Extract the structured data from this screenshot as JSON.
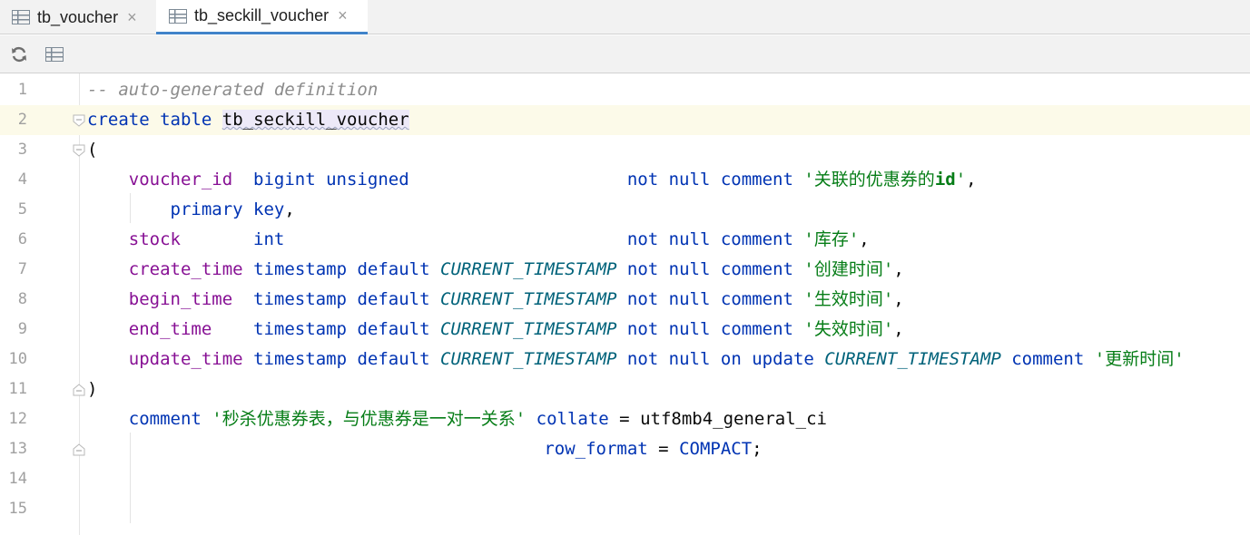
{
  "tabs": [
    {
      "label": "tb_voucher",
      "icon": "table-icon",
      "close": "×",
      "active": false
    },
    {
      "label": "tb_seckill_voucher",
      "icon": "table-icon",
      "close": "×",
      "active": true
    }
  ],
  "toolbar": {
    "buttons": [
      "refresh-icon",
      "table-view-icon"
    ]
  },
  "editor": {
    "line_numbers": [
      "1",
      "2",
      "3",
      "4",
      "5",
      "6",
      "7",
      "8",
      "9",
      "10",
      "11",
      "12",
      "13",
      "14",
      "15"
    ],
    "current_line": 2,
    "lines": {
      "l1": {
        "comment": "-- auto-generated definition"
      },
      "l2": {
        "kw_create": "create",
        "kw_table": "table",
        "table_name": "tb_seckill_voucher"
      },
      "l3": {
        "paren": "("
      },
      "l4": {
        "col": "voucher_id",
        "type": "bigint unsigned",
        "notnull": "not null",
        "kw_comment": "comment",
        "str_open": "'关联的优惠券的",
        "str_id": "id",
        "str_close": "'",
        "comma": ","
      },
      "l5": {
        "kw": "primary key",
        "comma": ","
      },
      "l6": {
        "col": "stock",
        "type": "int",
        "notnull": "not null",
        "kw_comment": "comment",
        "str": "'库存'",
        "comma": ","
      },
      "l7": {
        "col": "create_time",
        "type": "timestamp",
        "kw_default": "default",
        "fn": "CURRENT_TIMESTAMP",
        "notnull": "not null",
        "kw_comment": "comment",
        "str": "'创建时间'",
        "comma": ","
      },
      "l8": {
        "col": "begin_time",
        "type": "timestamp",
        "kw_default": "default",
        "fn": "CURRENT_TIMESTAMP",
        "notnull": "not null",
        "kw_comment": "comment",
        "str": "'生效时间'",
        "comma": ","
      },
      "l9": {
        "col": "end_time",
        "type": "timestamp",
        "kw_default": "default",
        "fn": "CURRENT_TIMESTAMP",
        "notnull": "not null",
        "kw_comment": "comment",
        "str": "'失效时间'",
        "comma": ","
      },
      "l10": {
        "col": "update_time",
        "type": "timestamp",
        "kw_default": "default",
        "fn": "CURRENT_TIMESTAMP",
        "notnull": "not null",
        "kw_on_update": "on update",
        "fn2": "CURRENT_TIMESTAMP",
        "kw_comment": "comment",
        "str": "'更新时间'"
      },
      "l11": {
        "paren": ")"
      },
      "l12": {
        "kw_comment": "comment",
        "str": "'秒杀优惠券表，与优惠券是一对一关系'",
        "kw_collate": "collate",
        "eq": "=",
        "value": "utf8mb4_general_ci"
      },
      "l13": {
        "kw_row_format": "row_format",
        "eq": "=",
        "kw_value": "COMPACT",
        "semi": ";"
      }
    }
  },
  "colors": {
    "keyword": "#0033b3",
    "column": "#871094",
    "function": "#00627a",
    "string": "#067d17",
    "comment": "#8c8c8c",
    "current_line": "#fcfae9",
    "tab_underline": "#4083c9"
  }
}
